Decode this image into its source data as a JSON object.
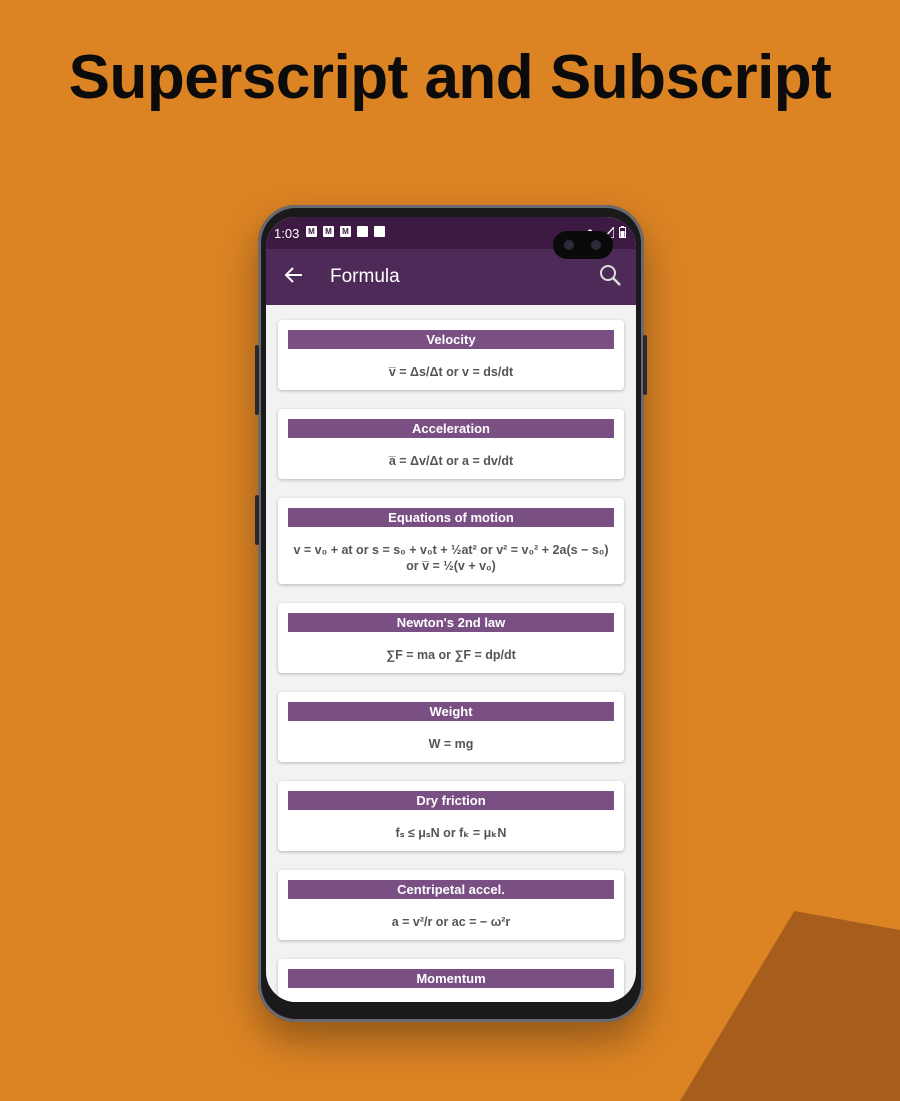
{
  "headline": "Superscript and Subscript",
  "status": {
    "time": "1:03"
  },
  "appbar": {
    "title": "Formula"
  },
  "icons": {
    "back": "arrow-left-icon",
    "search": "search-icon"
  },
  "colors": {
    "background": "#dc8424",
    "appbar": "#4e2a58",
    "card_header": "#7a4f84"
  },
  "cards": [
    {
      "title": "Velocity",
      "formula": "v̅ = Δs/Δt or v = ds/dt"
    },
    {
      "title": "Acceleration",
      "formula": "a̅ = Δv/Δt or a = dv/dt"
    },
    {
      "title": "Equations of motion",
      "formula": "v = v₀ + at or s = s₀ + v₀t + ½at² or v² = v₀² + 2a(s − s₀) or v̅ = ½(v + v₀)"
    },
    {
      "title": "Newton's 2nd law",
      "formula": "∑F = ma or ∑F = dp/dt"
    },
    {
      "title": "Weight",
      "formula": "W = mg"
    },
    {
      "title": "Dry friction",
      "formula": "fₛ ≤ μₛN or fₖ = μₖN"
    },
    {
      "title": "Centripetal accel.",
      "formula": "a = v²/r or ac = − ω²r"
    },
    {
      "title": "Momentum",
      "formula": ""
    }
  ]
}
